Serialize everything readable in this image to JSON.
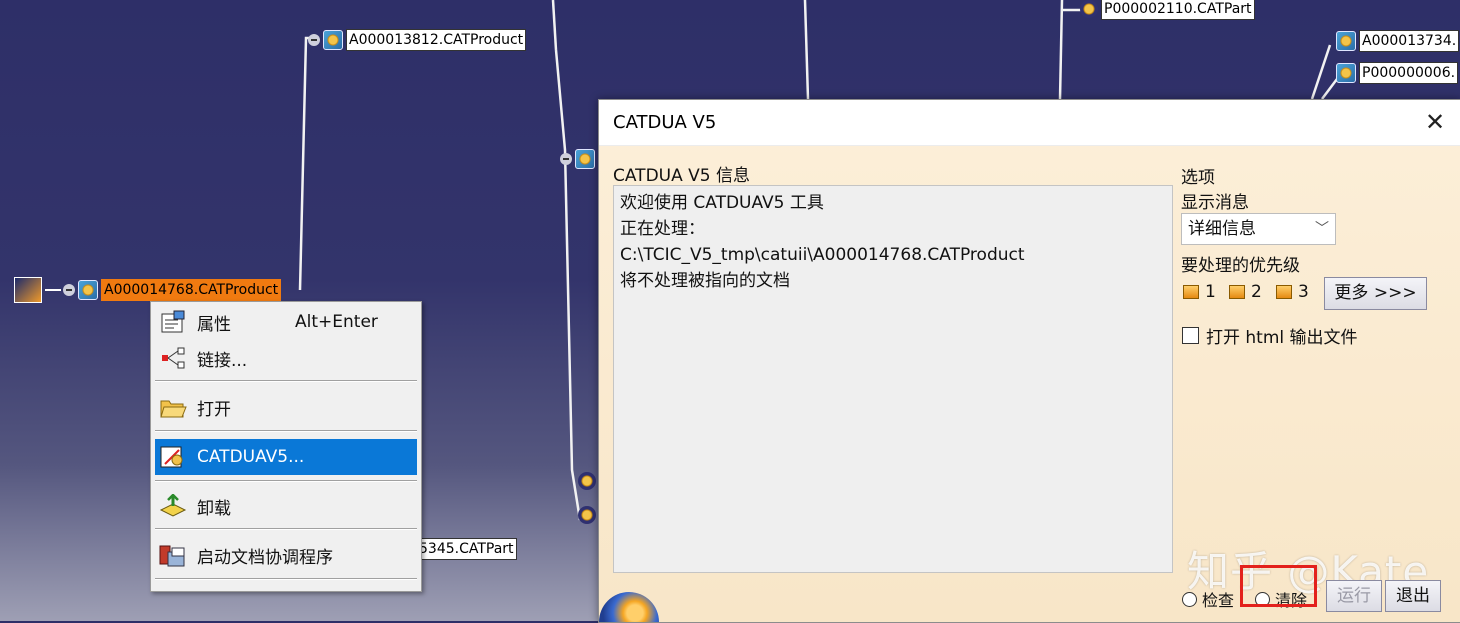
{
  "tree": {
    "nodes": {
      "n1": "A000013812.CATProduct",
      "n2": "P000002110.CATPart",
      "n3": "A000013734.",
      "n4": "P000000006.",
      "selected": "A000014768.CATProduct",
      "n5": "5345.CATPart"
    }
  },
  "context_menu": {
    "items": [
      {
        "label": "属性",
        "shortcut": "Alt+Enter"
      },
      {
        "label": "链接..."
      },
      {
        "label": "打开"
      },
      {
        "label": "CATDUAV5..."
      },
      {
        "label": "卸载"
      },
      {
        "label": "启动文档协调程序"
      }
    ]
  },
  "dialog": {
    "title": "CATDUA V5",
    "info_label": "CATDUA V5 信息",
    "info_lines": [
      "欢迎使用 CATDUAV5 工具",
      "正在处理：",
      "C:\\TCIC_V5_tmp\\catuii\\A000014768.CATProduct",
      "将不处理被指向的文档"
    ],
    "options_label": "选项",
    "show_msg_label": "显示消息",
    "show_msg_value": "详细信息",
    "priority_label": "要处理的优先级",
    "priority_levels": [
      "1",
      "2",
      "3"
    ],
    "more_button": "更多 >>>",
    "html_output_label": "打开 html 输出文件",
    "radio_check": "检查",
    "radio_clean": "清除",
    "run_button": "运行",
    "exit_button": "退出"
  },
  "watermark": "知乎 @Kate"
}
